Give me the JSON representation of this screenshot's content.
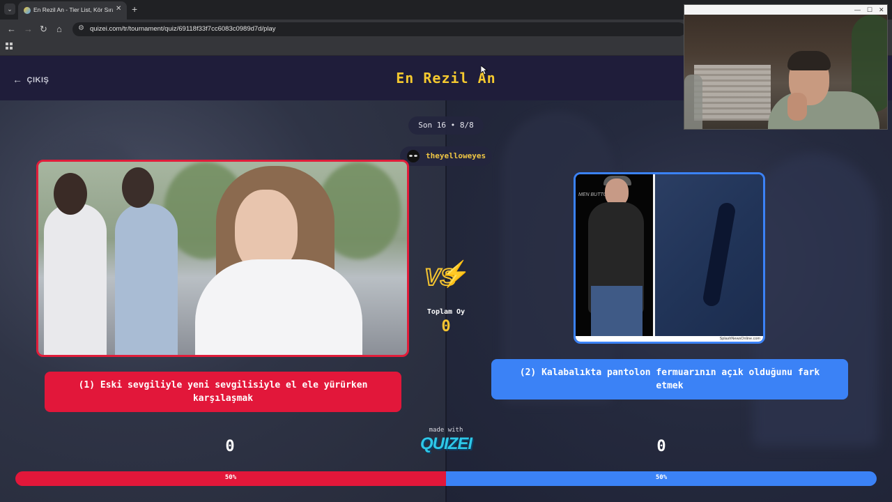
{
  "browser": {
    "tab_title": "En Rezil An - Tier List, Kör Sıralama",
    "tab_close": "✕",
    "new_tab": "+",
    "url": "quizei.com/tr/tournament/quiz/69118f33f7cc6083c0989d7d/play",
    "nav": {
      "back": "←",
      "forward": "→",
      "reload": "↻",
      "home": "⌂"
    }
  },
  "header": {
    "exit_label": "ÇIKIŞ",
    "title": "En Rezil An"
  },
  "round": {
    "label": "Son 16 • 8/8"
  },
  "user": {
    "name": "theyelloweyes"
  },
  "options": {
    "left": {
      "label": "(1) Eski sevgiliyle yeni sevgilisiyle el ele yürürken karşılaşmak",
      "score": "0",
      "percent_text": "50%",
      "percent": 50
    },
    "right": {
      "label": "(2) Kalabalıkta pantolon fermuarının açık olduğunu fark etmek",
      "score": "0",
      "percent_text": "50%",
      "percent": 50
    }
  },
  "right_image": {
    "backdrop_text": "MEN BUTTON",
    "caption": "SplashNewsOnline.com"
  },
  "versus": {
    "total_label": "Toplam Oy",
    "total_value": "0"
  },
  "branding": {
    "made_with": "made with",
    "logo": "QUIZEI"
  },
  "colors": {
    "accent_yellow": "#f5c431",
    "left_red": "#e2173a",
    "right_blue": "#3b82f6",
    "header_bg": "#1f1d3a"
  },
  "webcam": {
    "controls": {
      "minimize": "—",
      "maximize": "☐",
      "close": "✕"
    }
  }
}
